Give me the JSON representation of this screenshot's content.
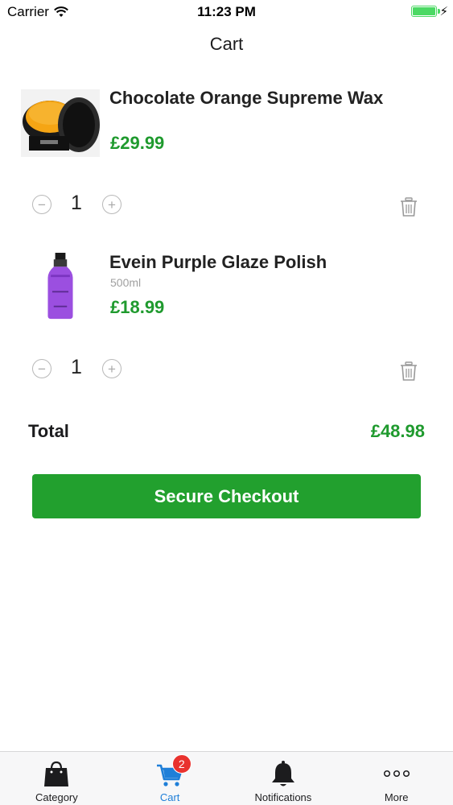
{
  "status_bar": {
    "carrier": "Carrier",
    "time": "11:23 PM",
    "battery_level": 1.0
  },
  "nav": {
    "title": "Cart"
  },
  "cart": {
    "items": [
      {
        "name": "Chocolate Orange Supreme Wax",
        "variant": "",
        "price": "£29.99",
        "quantity": "1",
        "image": "wax-tin"
      },
      {
        "name": "Evein Purple Glaze Polish",
        "variant": "500ml",
        "price": "£18.99",
        "quantity": "1",
        "image": "purple-bottle"
      }
    ]
  },
  "summary": {
    "total_label": "Total",
    "total_value": "£48.98"
  },
  "checkout": {
    "label": "Secure Checkout",
    "color": "#22a02e"
  },
  "tabs": [
    {
      "label": "Category",
      "icon": "shopping-bag-icon",
      "active": false
    },
    {
      "label": "Cart",
      "icon": "cart-icon",
      "active": true,
      "badge": "2"
    },
    {
      "label": "Notifications",
      "icon": "bell-icon",
      "active": false
    },
    {
      "label": "More",
      "icon": "more-icon",
      "active": false
    }
  ],
  "colors": {
    "price": "#1f9a2e",
    "accent": "#1f7fd8",
    "badge": "#e9322e"
  }
}
